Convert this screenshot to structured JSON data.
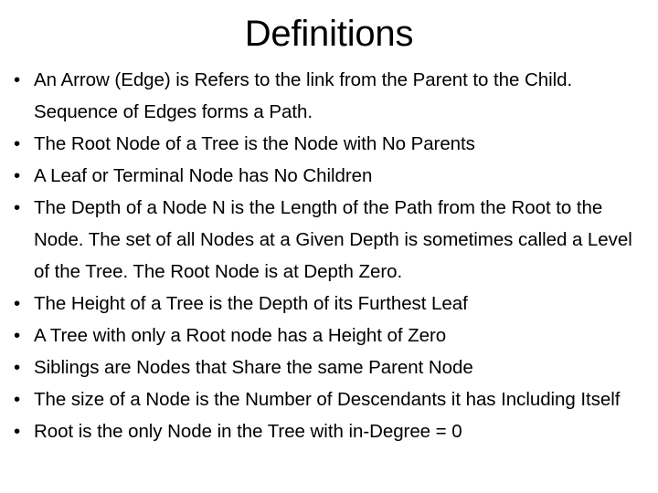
{
  "slide": {
    "title": "Definitions",
    "background_color": "#ffffff",
    "text_color": "#000000",
    "bullet_marker": "•",
    "bullets": [
      {
        "text": "An Arrow (Edge) is Refers to the link from the Parent to the Child. Sequence of Edges forms a Path."
      },
      {
        "text": "The Root Node of a Tree is the Node with No Parents"
      },
      {
        "text": "A Leaf or Terminal Node has No Children"
      },
      {
        "text": "The Depth of a Node N is the Length of the Path from the Root to the Node. The set of all Nodes at a Given Depth is sometimes called a Level of the Tree. The Root Node is at Depth Zero."
      },
      {
        "text": "The Height of a Tree is the Depth of its Furthest Leaf"
      },
      {
        "text": "A Tree with only a Root node has a Height of Zero"
      },
      {
        "text": "Siblings are Nodes that Share the same Parent Node"
      },
      {
        "text": "The size of a Node is the Number of Descendants it has Including Itself"
      },
      {
        "text": "Root is the only Node in the Tree with in-Degree = 0"
      }
    ]
  }
}
